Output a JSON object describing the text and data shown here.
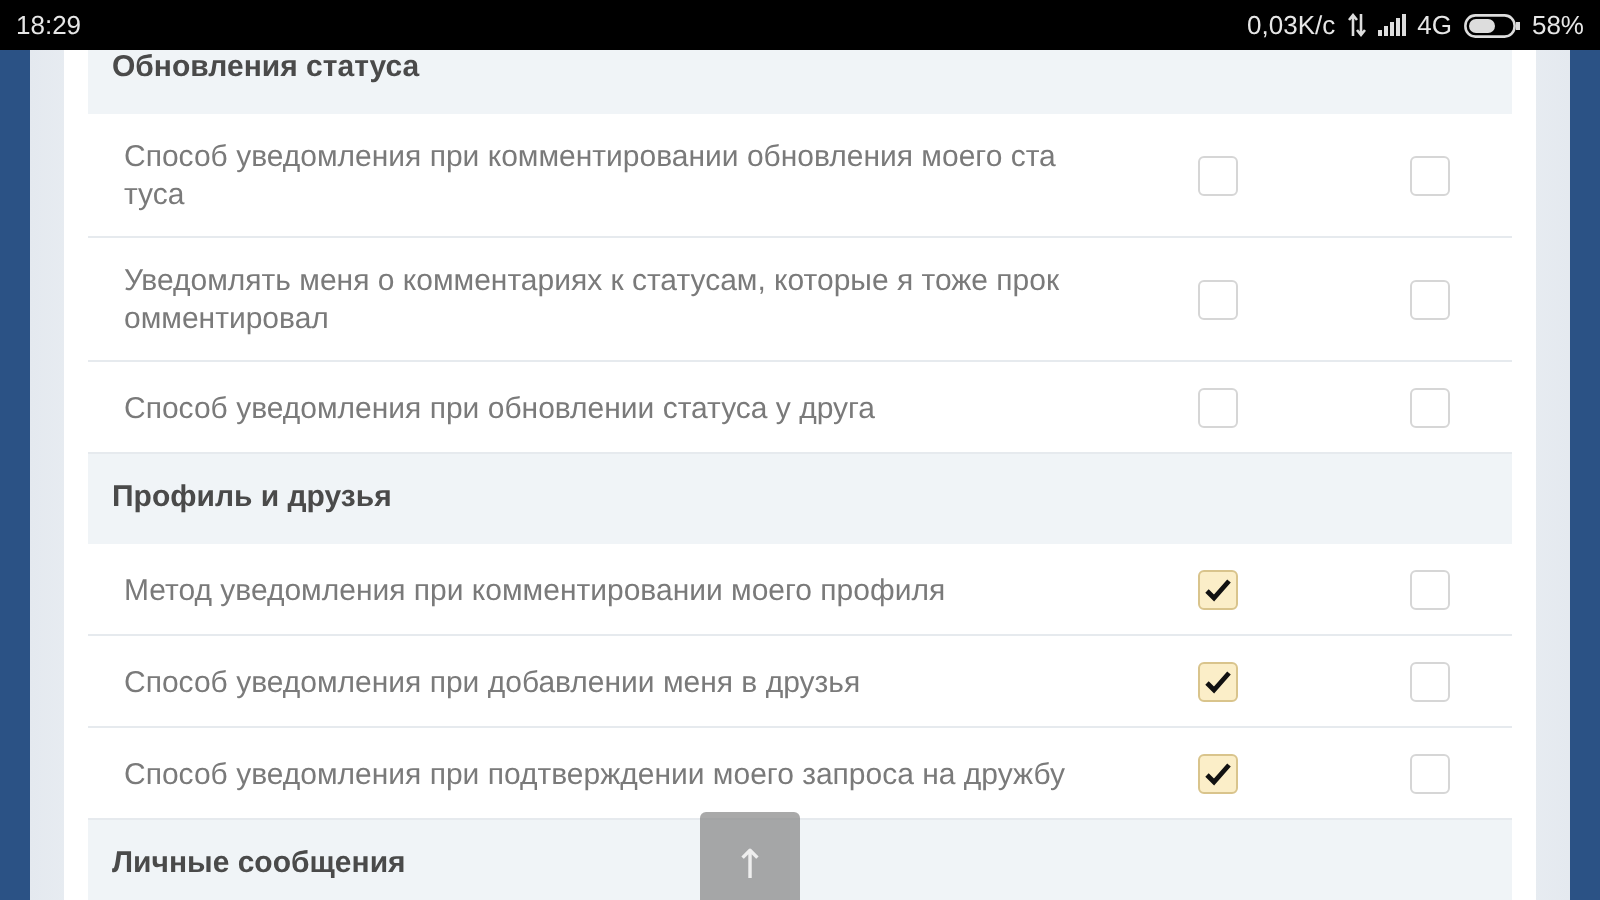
{
  "status_bar": {
    "time": "18:29",
    "speed": "0,03K/с",
    "network": "4G",
    "battery": "58%"
  },
  "sections": [
    {
      "title": "Обновления статуса",
      "rows": [
        {
          "label": "Способ уведомления при комментировании обновления моего статуса",
          "checks": [
            false,
            false
          ]
        },
        {
          "label": "Уведомлять меня о комментариях к статусам, которые я тоже прокомментировал",
          "checks": [
            false,
            false
          ]
        },
        {
          "label": "Способ уведомления при обновлении статуса у друга",
          "checks": [
            false,
            false
          ]
        }
      ]
    },
    {
      "title": "Профиль и друзья",
      "rows": [
        {
          "label": "Метод уведомления при комментировании моего профиля",
          "checks": [
            true,
            false
          ]
        },
        {
          "label": "Способ уведомления при добавлении меня в друзья",
          "checks": [
            true,
            false
          ]
        },
        {
          "label": "Способ уведомления при подтверждении моего запроса на дружбу",
          "checks": [
            true,
            false
          ]
        }
      ]
    },
    {
      "title": "Личные сообщения"
    }
  ],
  "scroll_top_button": {
    "label": "↑"
  }
}
